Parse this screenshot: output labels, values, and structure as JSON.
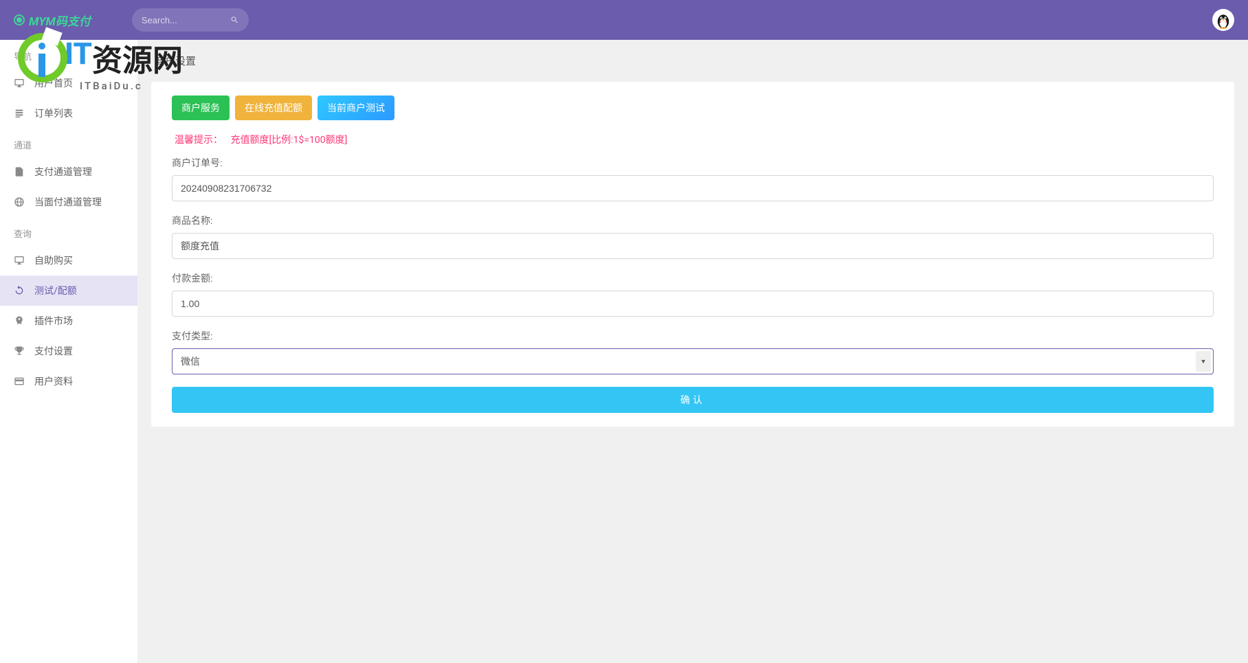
{
  "header": {
    "brand": "MYM码支付",
    "search_placeholder": "Search..."
  },
  "watermark": {
    "text_it": "IT",
    "text_cn": "资源网",
    "sub": "ITBaiDu.c"
  },
  "sidebar": {
    "sections": [
      {
        "header": "导航",
        "items": [
          {
            "label": "用户首页",
            "icon": "monitor",
            "name": "sidebar-item-home"
          },
          {
            "label": "订单列表",
            "icon": "list",
            "name": "sidebar-item-orders"
          }
        ]
      },
      {
        "header": "通道",
        "items": [
          {
            "label": "支付通道管理",
            "icon": "doc",
            "name": "sidebar-item-pay-channel"
          },
          {
            "label": "当面付通道管理",
            "icon": "globe",
            "name": "sidebar-item-face-channel"
          }
        ]
      },
      {
        "header": "查询",
        "items": [
          {
            "label": "自助购买",
            "icon": "monitor",
            "name": "sidebar-item-self-buy"
          },
          {
            "label": "测试/配额",
            "icon": "refresh",
            "name": "sidebar-item-test-quota",
            "active": true
          },
          {
            "label": "插件市场",
            "icon": "rocket",
            "name": "sidebar-item-plugin"
          },
          {
            "label": "支付设置",
            "icon": "trophy",
            "name": "sidebar-item-pay-settings"
          },
          {
            "label": "用户资料",
            "icon": "card",
            "name": "sidebar-item-user-profile"
          }
        ]
      }
    ]
  },
  "page": {
    "title": "商户设置",
    "tabs": {
      "green": "商户服务",
      "yellow": "在线充值配额",
      "blue": "当前商户测试"
    },
    "hint_label": "温馨提示：",
    "hint_text": "充值额度[比例:1$=100额度]",
    "form": {
      "order_label": "商户订单号:",
      "order_value": "20240908231706732",
      "product_label": "商品名称:",
      "product_value": "额度充值",
      "amount_label": "付款金额:",
      "amount_value": "1.00",
      "paytype_label": "支付类型:",
      "paytype_selected": "微信",
      "submit_label": "确认"
    }
  }
}
